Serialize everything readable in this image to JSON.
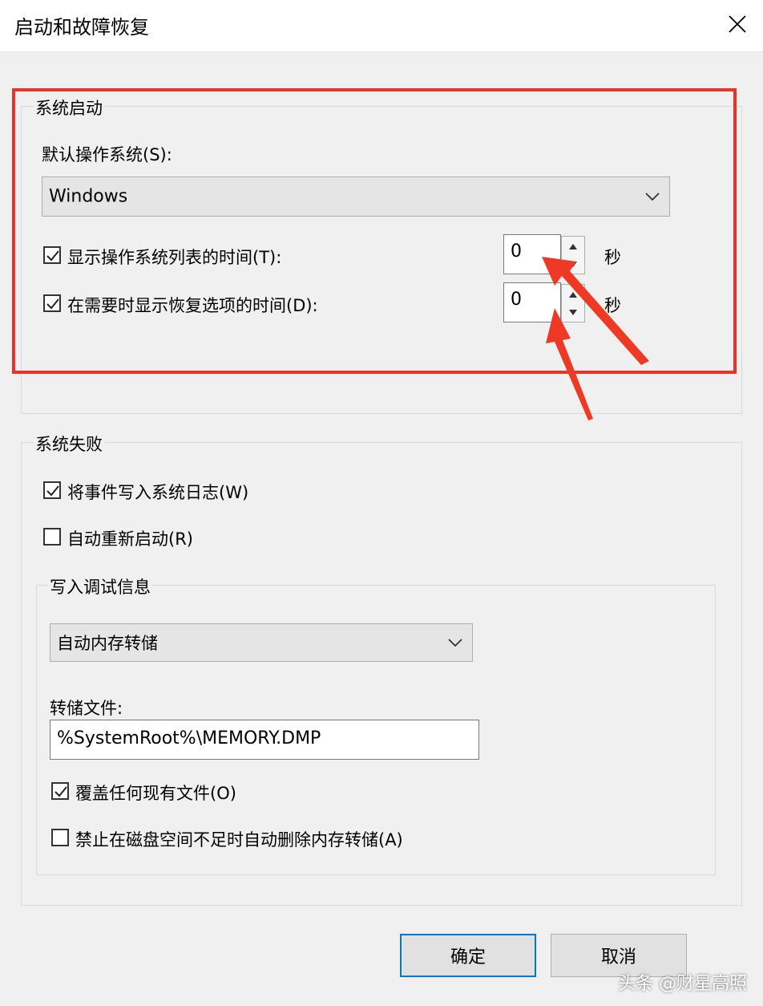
{
  "window": {
    "title": "启动和故障恢复"
  },
  "system_startup": {
    "legend": "系统启动",
    "default_os_label": "默认操作系统(S):",
    "default_os_value": "Windows",
    "show_os_list": {
      "label": "显示操作系统列表的时间(T):",
      "checked": true,
      "value": "0",
      "unit": "秒"
    },
    "show_recovery": {
      "label": "在需要时显示恢复选项的时间(D):",
      "checked": true,
      "value": "0",
      "unit": "秒"
    }
  },
  "system_failure": {
    "legend": "系统失败",
    "write_event_log": {
      "label": "将事件写入系统日志(W)",
      "checked": true
    },
    "auto_restart": {
      "label": "自动重新启动(R)",
      "checked": false
    },
    "debug_info": {
      "legend": "写入调试信息",
      "dump_type": "自动内存转储",
      "dump_file_label": "转储文件:",
      "dump_file_value": "%SystemRoot%\\MEMORY.DMP",
      "overwrite": {
        "label": "覆盖任何现有文件(O)",
        "checked": true
      },
      "disable_auto_delete": {
        "label": "禁止在磁盘空间不足时自动删除内存转储(A)",
        "checked": false
      }
    }
  },
  "buttons": {
    "ok": "确定",
    "cancel": "取消"
  },
  "annotation": {
    "highlight_color": "#e8332a",
    "arrow_color": "#ee3a24"
  },
  "watermark": "头条 @财星高照"
}
